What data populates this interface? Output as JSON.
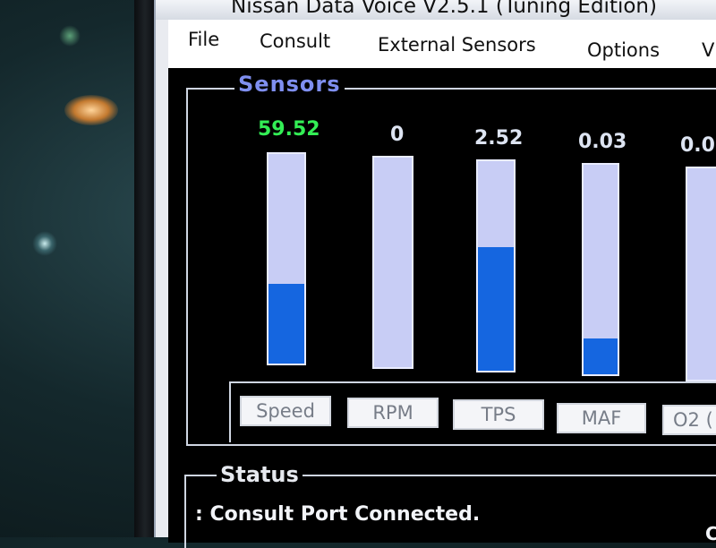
{
  "window": {
    "title": "Nissan Data Voice V2.5.1 (Tuning Edition)"
  },
  "menu": {
    "items": [
      {
        "label": "File"
      },
      {
        "label": "Consult"
      },
      {
        "label": "External Sensors"
      },
      {
        "label": "Options"
      },
      {
        "label": "V"
      }
    ]
  },
  "sensors": {
    "section_label": "Sensors",
    "gauges": [
      {
        "name": "Speed",
        "value": "59.52",
        "fill_percent": 38,
        "value_color": "#33ee55"
      },
      {
        "name": "RPM",
        "value": "0",
        "fill_percent": 0,
        "value_color": "#dde4f2"
      },
      {
        "name": "TPS",
        "value": "2.52",
        "fill_percent": 59,
        "value_color": "#dde4f2"
      },
      {
        "name": "MAF",
        "value": "0.03",
        "fill_percent": 17,
        "value_color": "#dde4f2"
      },
      {
        "name": "O2 (",
        "value": "0.0",
        "fill_percent": 0,
        "value_color": "#dde4f2"
      }
    ]
  },
  "status": {
    "section_label": "Status",
    "message": ": Consult Port Connected.",
    "right_fragment": "C"
  },
  "colors": {
    "bar_fill": "#1566e0",
    "bar_track": "#c8cdf5",
    "sensors_legend": "#7f8ff0",
    "background": "#000000"
  }
}
